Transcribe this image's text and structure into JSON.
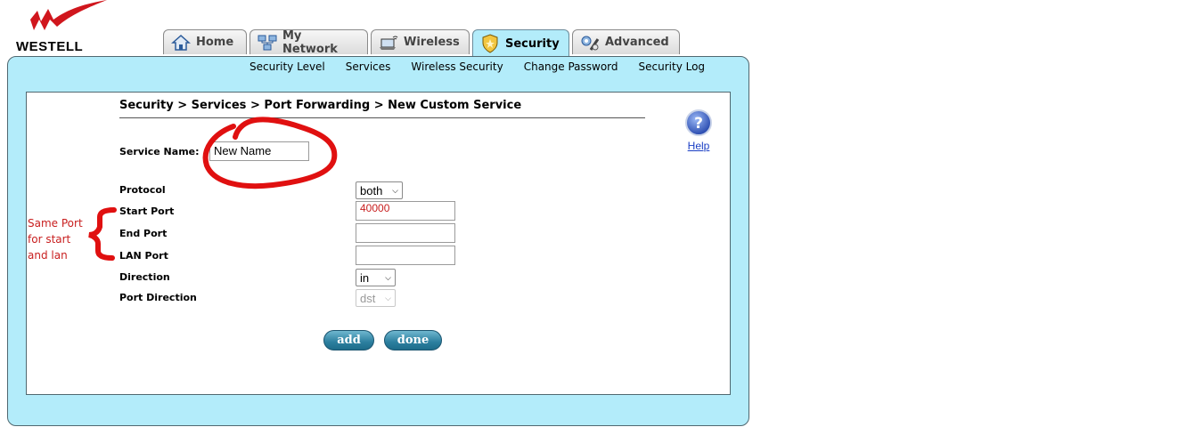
{
  "logo": {
    "text": "WESTELL"
  },
  "tabs": [
    {
      "label": "Home",
      "icon": "home-icon"
    },
    {
      "label": "My Network",
      "icon": "network-icon"
    },
    {
      "label": "Wireless",
      "icon": "wireless-icon"
    },
    {
      "label": "Security",
      "icon": "security-shield-icon",
      "active": true
    },
    {
      "label": "Advanced",
      "icon": "advanced-tools-icon"
    }
  ],
  "subnav": [
    "Security Level",
    "Services",
    "Wireless Security",
    "Change Password",
    "Security Log"
  ],
  "breadcrumb": "Security > Services > Port Forwarding > New Custom Service",
  "help": {
    "label": "Help",
    "icon": "help-question-icon"
  },
  "form": {
    "service_name_label": "Service Name:",
    "service_name_value": "New Name",
    "protocol_label": "Protocol",
    "protocol_value": "both",
    "start_port_label": "Start Port",
    "start_port_value": "40000",
    "end_port_label": "End Port",
    "end_port_value": "",
    "lan_port_label": "LAN Port",
    "lan_port_value": "",
    "direction_label": "Direction",
    "direction_value": "in",
    "port_direction_label": "Port Direction",
    "port_direction_value": "dst"
  },
  "buttons": {
    "add": "add",
    "done": "done"
  },
  "annotation": {
    "lines": [
      "Same Port",
      "for  start",
      "and lan"
    ],
    "color": "#c81e1e"
  },
  "colors": {
    "panel": "#b3ecfa",
    "accent_red": "#e01010",
    "button": "#2c7f9f"
  }
}
